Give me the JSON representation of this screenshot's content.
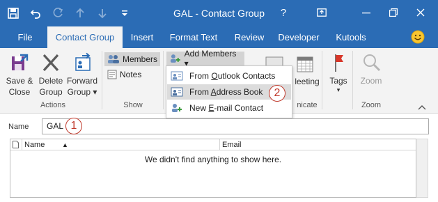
{
  "window": {
    "title": "GAL - Contact Group",
    "help": "?",
    "restore_icon": "ribbon-display-options-icon"
  },
  "quick_access": {
    "icons": [
      "save-icon",
      "undo-icon",
      "redo-icon",
      "move-up-icon",
      "move-down-icon",
      "customize-qat-icon"
    ]
  },
  "tabs": [
    {
      "label": "File"
    },
    {
      "label": "Contact Group",
      "active": true
    },
    {
      "label": "Insert"
    },
    {
      "label": "Format Text"
    },
    {
      "label": "Review"
    },
    {
      "label": "Developer"
    },
    {
      "label": "Kutools"
    }
  ],
  "ribbon": {
    "actions": {
      "save_close": {
        "line1": "Save &",
        "line2": "Close"
      },
      "delete_group": {
        "line1": "Delete",
        "line2": "Group"
      },
      "forward_group": {
        "line1": "Forward",
        "line2": "Group ▾"
      },
      "label": "Actions"
    },
    "show": {
      "members": "Members",
      "notes": "Notes",
      "label": "Show"
    },
    "add_members": {
      "label": "Add Members ▾"
    },
    "partial_group_label": "nicate",
    "meeting_label": "leeting",
    "tags": {
      "label": "Tags",
      "caret": "▾"
    },
    "zoom": {
      "button": "Zoom",
      "label": "Zoom"
    }
  },
  "dropdown": {
    "items": [
      {
        "pre": "From ",
        "ul": "O",
        "post": "utlook Contacts"
      },
      {
        "pre": "From ",
        "ul": "A",
        "post": "ddress Book"
      },
      {
        "pre": "New ",
        "ul": "E",
        "post": "-mail Contact"
      }
    ],
    "highlighted_index": 1
  },
  "steps": {
    "first": "1",
    "second": "2"
  },
  "form": {
    "name_label": "Name",
    "name_value": "GAL"
  },
  "members_table": {
    "columns": [
      "Name",
      "Email"
    ],
    "sort_indicator": "▲",
    "empty_text": "We didn't find anything to show here."
  },
  "colors": {
    "accent": "#2b6cb5",
    "annotation": "#c0392b"
  }
}
